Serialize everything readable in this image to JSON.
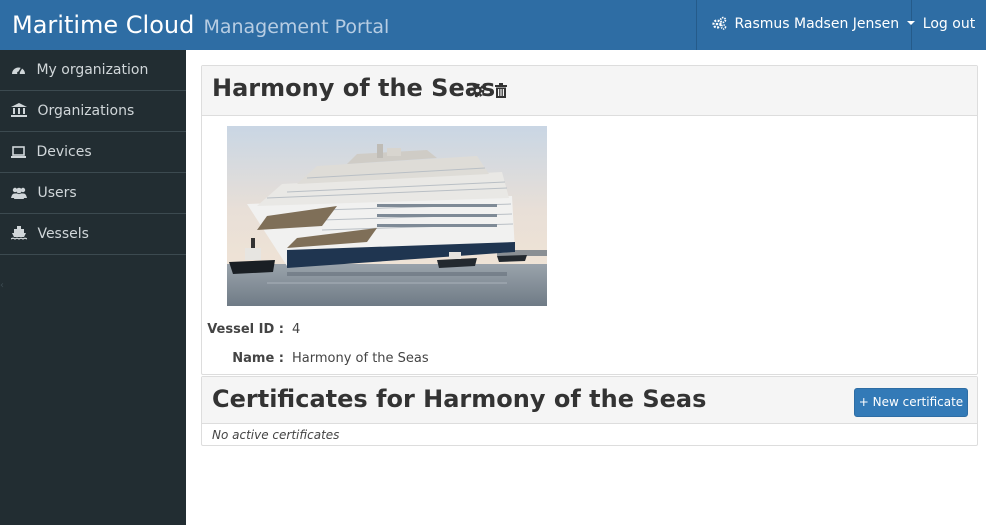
{
  "header": {
    "brand_main": "Maritime Cloud",
    "brand_sub": "Management Portal",
    "user_name": "Rasmus Madsen Jensen",
    "logout_label": "Log out",
    "bar_color": "#2e6da4"
  },
  "sidebar": {
    "items": [
      {
        "label": "My organization",
        "icon": "dashboard-icon"
      },
      {
        "label": "Organizations",
        "icon": "bank-icon"
      },
      {
        "label": "Devices",
        "icon": "laptop-icon"
      },
      {
        "label": "Users",
        "icon": "users-icon"
      },
      {
        "label": "Vessels",
        "icon": "ship-icon"
      }
    ],
    "background": "#222d32"
  },
  "vessel": {
    "title": "Harmony of the Seas",
    "image_alt": "cruise ship photo",
    "fields": [
      {
        "label": "Vessel ID :",
        "value": "4"
      },
      {
        "label": "Name :",
        "value": "Harmony of the Seas"
      }
    ]
  },
  "certificates": {
    "title": "Certificates for Harmony of the Seas",
    "new_button_label": "+ New certificate",
    "empty_text": "No active certificates"
  }
}
